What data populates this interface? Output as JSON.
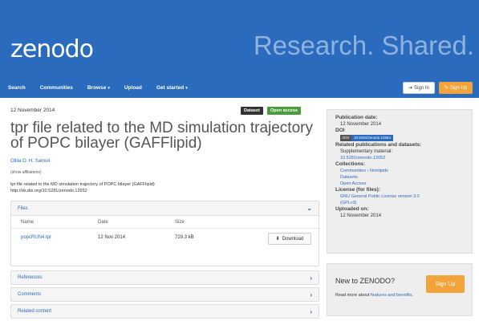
{
  "header": {
    "logo": "zenodo",
    "tagline": "Research. Shared.",
    "nav": [
      {
        "label": "Search",
        "caret": ""
      },
      {
        "label": "Communities",
        "caret": ""
      },
      {
        "label": "Browse",
        "caret": "▾"
      },
      {
        "label": "Upload",
        "caret": ""
      },
      {
        "label": "Get started",
        "caret": "▾"
      }
    ],
    "signin_label": "Sign In",
    "signup_label": "Sign Up"
  },
  "record": {
    "publication_date": "12 November 2014",
    "badges": {
      "dataset": "Dataset",
      "open_access": "Open access"
    },
    "title": "tpr file related to the MD simulation trajectory of POPC bilayer (GAFFlipid)",
    "author": "Ollila O. H. Samuli",
    "show_affiliations": "(show affiliations)",
    "description_line1": "tpr file related to the  MD simulation trajectory of POPC bilayer (GAFFlipid)",
    "description_line2": "http://dx.doi.org/10.5281/zenodo.12652"
  },
  "files": {
    "heading": "Files",
    "columns": [
      "Name",
      "Date",
      "Size"
    ],
    "rows": [
      {
        "name": "popcRUN4.tpr",
        "date": "12 Nov 2014",
        "size": "729.3 kB"
      }
    ],
    "download_label": "Download"
  },
  "sections": [
    {
      "label": "References"
    },
    {
      "label": "Comments"
    },
    {
      "label": "Related content"
    }
  ],
  "sidebar": {
    "pubdate_label": "Publication date:",
    "pubdate_value": "12 November 2014",
    "doi_label": "DOI",
    "doi_prefix": "DOI",
    "doi_value": "10.5281/zenodo.12654",
    "related_label": "Related publications and datasets:",
    "related_sub": "Supplementary material:",
    "related_link": "10.5281/zenodo.12652",
    "collections_label": "Collections:",
    "collections": [
      "Communities › Nmrlipids",
      "Datasets",
      "Open Access"
    ],
    "license_label": "License (for files):",
    "license_value_1": "GNU General Public License version 3.0",
    "license_value_2": "(GPLv3)",
    "uploaded_label": "Uploaded on:",
    "uploaded_value": "12 November 2014"
  },
  "newbox": {
    "title": "New to ZENODO?",
    "text_prefix": "Read more about ",
    "text_link": "features and benefits",
    "text_suffix": ".",
    "signup_label": "Sign Up"
  },
  "colors": {
    "brand": "#2a6bbd",
    "accent": "#f2a33a",
    "open_access": "#4a9d3b"
  }
}
